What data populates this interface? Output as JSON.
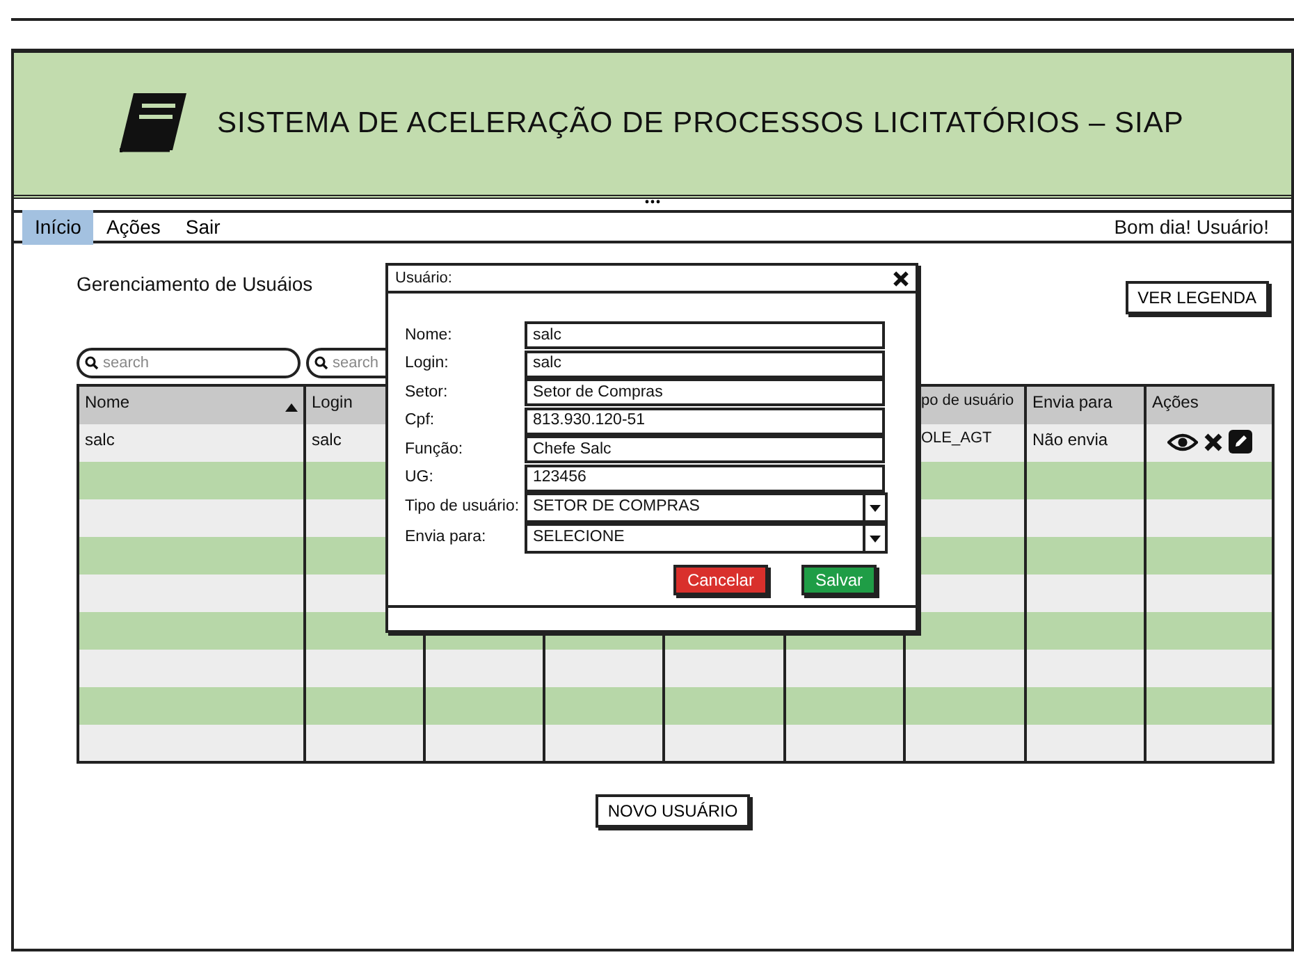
{
  "header": {
    "title": "SISTEMA DE ACELERAÇÃO DE PROCESSOS LICITATÓRIOS – SIAP"
  },
  "nav": {
    "items": [
      {
        "label": "Início",
        "selected": true
      },
      {
        "label": "Ações",
        "selected": false
      },
      {
        "label": "Sair",
        "selected": false
      }
    ],
    "greeting": "Bom dia! Usuário!"
  },
  "page": {
    "title": "Gerenciamento de Usuáios",
    "legend_button": "VER LEGENDA",
    "new_button": "NOVO USUÁRIO"
  },
  "search_fields": [
    {
      "placeholder": "search"
    },
    {
      "placeholder": "search"
    }
  ],
  "table": {
    "columns": [
      {
        "label": "Nome",
        "sorted": true
      },
      {
        "label": "Login",
        "sorted": false
      },
      {},
      {},
      {},
      {},
      {
        "label": "po de usuário",
        "sorted": false
      },
      {
        "label": "Envia para",
        "sorted": false
      },
      {
        "label": "Ações",
        "sorted": false
      }
    ],
    "rows": [
      {
        "cells": [
          "salc",
          "salc",
          null,
          null,
          null,
          null,
          "OLE_AGT",
          "Não envia",
          null
        ],
        "actions": true
      },
      {
        "actions": false
      },
      {
        "actions": false
      },
      {
        "actions": false
      },
      {
        "actions": false
      },
      {
        "actions": false
      },
      {
        "actions": false
      },
      {
        "actions": false
      },
      {
        "actions": false
      }
    ]
  },
  "dialog": {
    "title": "Usuário:",
    "fields": [
      {
        "kind": "text",
        "label": "Nome:",
        "value": "salc"
      },
      {
        "kind": "text",
        "label": "Login:",
        "value": "salc"
      },
      {
        "kind": "text",
        "label": "Setor:",
        "value": "Setor de Compras"
      },
      {
        "kind": "text",
        "label": "Cpf:",
        "value": "813.930.120-51"
      },
      {
        "kind": "text",
        "label": "Função:",
        "value": "Chefe Salc"
      },
      {
        "kind": "text",
        "label": "UG:",
        "value": "123456"
      },
      {
        "kind": "select",
        "label": "Tipo de usuário:",
        "value": "SETOR DE COMPRAS"
      },
      {
        "kind": "select",
        "label": "Envia para:",
        "value": "SELECIONE"
      }
    ],
    "buttons": [
      {
        "kind": "cancel",
        "label": "Cancelar"
      },
      {
        "kind": "save",
        "label": "Salvar"
      }
    ]
  }
}
